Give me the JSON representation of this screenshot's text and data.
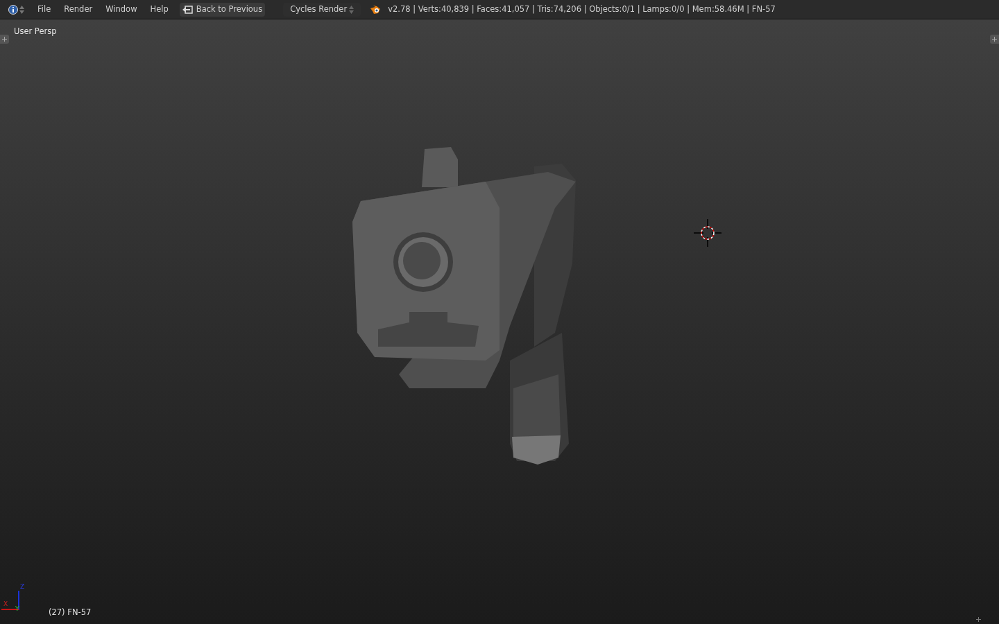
{
  "menu_bar": {
    "menus": [
      "File",
      "Render",
      "Window",
      "Help"
    ],
    "back_button": "Back to Previous",
    "render_engine": "Cycles Render",
    "stats": "v2.78 | Verts:40,839 | Faces:41,057 | Tris:74,206 | Objects:0/1 | Lamps:0/0 | Mem:58.46M | FN-57"
  },
  "viewport": {
    "view_label": "User Persp",
    "object_label": "(27) FN-57",
    "axes": {
      "x": "X",
      "y": "Y",
      "z": "Z"
    }
  }
}
